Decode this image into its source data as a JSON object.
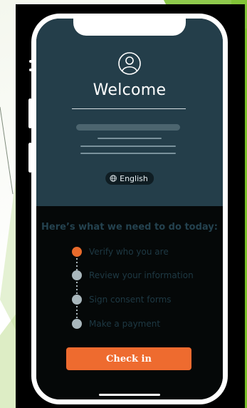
{
  "colors": {
    "green_accent": "#7bbf2a",
    "screen_top": "#243e4a",
    "screen_bottom": "#050808",
    "orange": "#ee6b2f",
    "step_pending": "#a9b7bc"
  },
  "header": {
    "avatar_icon": "user-circle-icon",
    "title": "Welcome"
  },
  "language": {
    "icon": "globe-icon",
    "label": "English"
  },
  "todo": {
    "title": "Here’s what we need to do today:",
    "steps": [
      {
        "label": "Verify who you are",
        "status": "active"
      },
      {
        "label": "Review your information",
        "status": "pending"
      },
      {
        "label": "Sign consent forms",
        "status": "pending"
      },
      {
        "label": "Make a payment",
        "status": "pending"
      }
    ]
  },
  "cta": {
    "label": "Check in"
  }
}
